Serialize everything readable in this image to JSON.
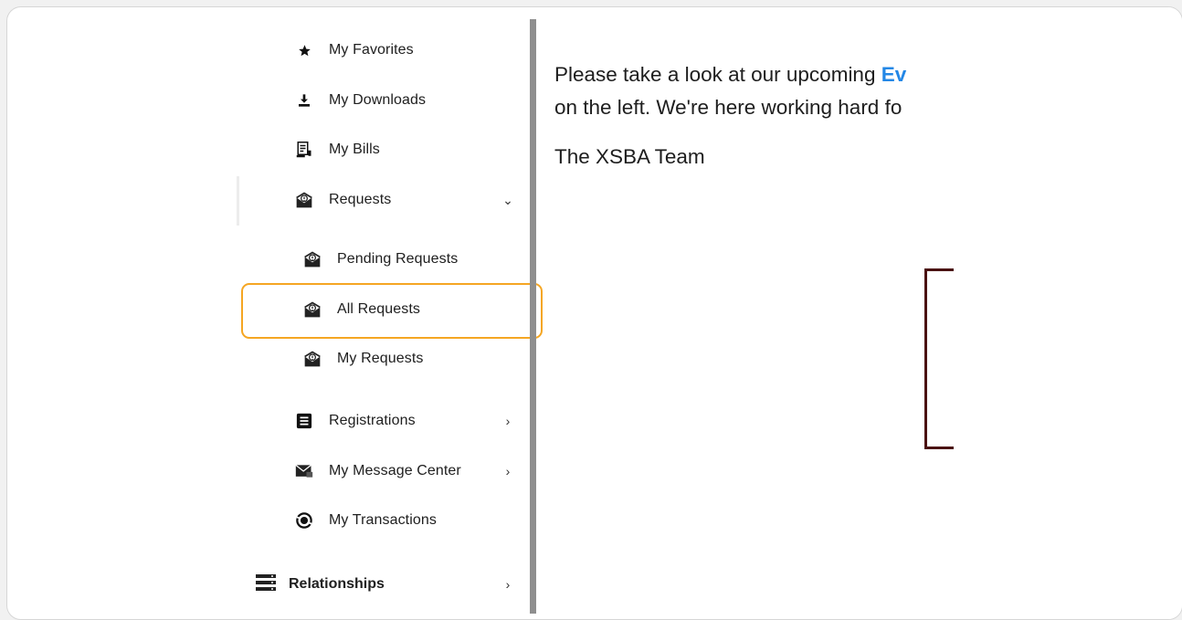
{
  "sidebar": {
    "items": [
      {
        "label": "My Favorites",
        "icon": "star-icon"
      },
      {
        "label": "My Downloads",
        "icon": "download-icon"
      },
      {
        "label": "My Bills",
        "icon": "bill-icon"
      },
      {
        "label": "Requests",
        "icon": "request-icon",
        "expanded": true
      },
      {
        "label": "Pending Requests",
        "icon": "request-icon"
      },
      {
        "label": "All Requests",
        "icon": "request-icon",
        "highlighted": true
      },
      {
        "label": "My Requests",
        "icon": "request-icon"
      },
      {
        "label": "Registrations",
        "icon": "registrations-icon"
      },
      {
        "label": "My Message Center",
        "icon": "message-icon"
      },
      {
        "label": "My Transactions",
        "icon": "transactions-icon"
      }
    ],
    "relationships": {
      "label": "Relationships",
      "icon": "server-icon"
    }
  },
  "content": {
    "line1_text": "Please take a look at our upcoming ",
    "line1_accent": "Ev",
    "line2_text": "on the left.  We're here working hard fo",
    "signature": "The XSBA Team"
  },
  "colors": {
    "highlight": "#f5a623",
    "accent_link": "#2387e6",
    "bracket": "#4a1212"
  }
}
